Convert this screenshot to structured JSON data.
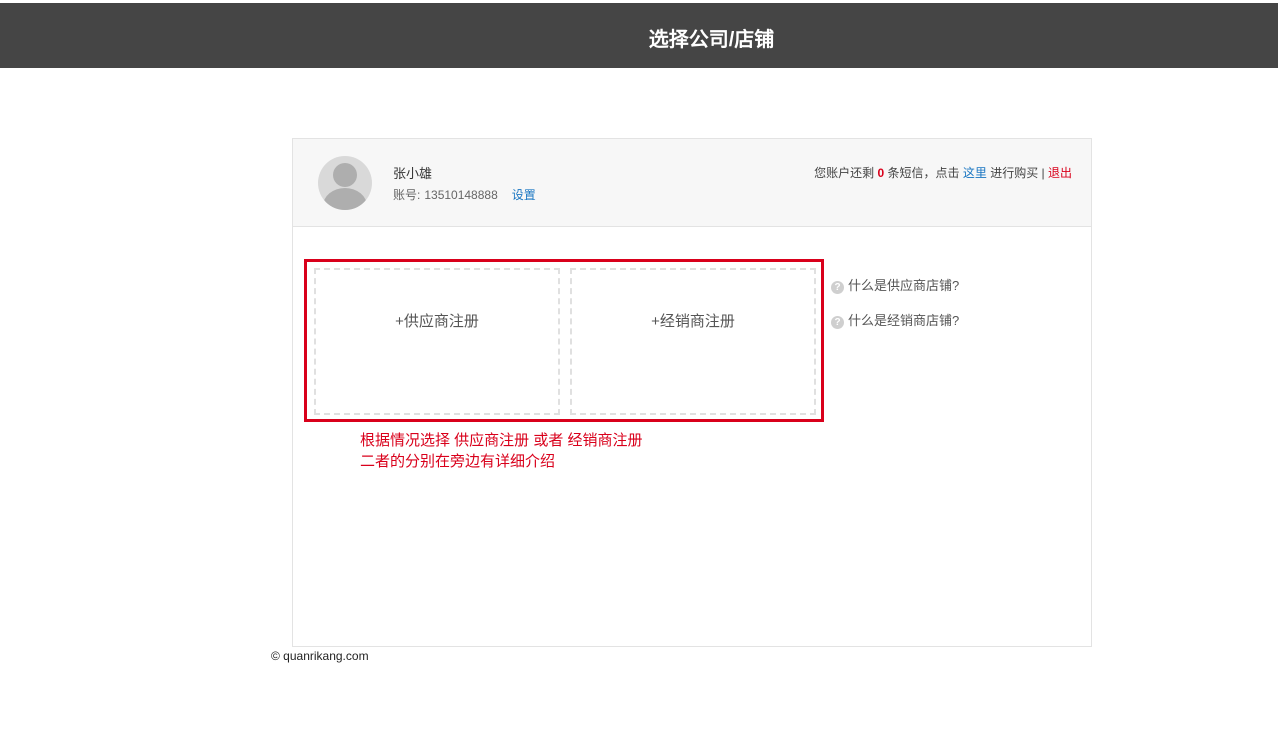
{
  "header": {
    "title": "选择公司/店铺"
  },
  "user": {
    "name": "张小雄",
    "account_label": "账号:",
    "account_number": "13510148888",
    "settings_label": "设置"
  },
  "sms": {
    "prefix": "您账户还剩",
    "count": "0",
    "middle": "条短信，点击",
    "link": "这里",
    "suffix": "进行购买 |",
    "logout": "退出"
  },
  "cards": {
    "supplier": "+供应商注册",
    "distributor": "+经销商注册"
  },
  "help": {
    "supplier_q": "什么是供应商店铺?",
    "distributor_q": "什么是经销商店铺?",
    "icon_glyph": "?"
  },
  "annotation": {
    "line1": "根据情况选择 供应商注册 或者 经销商注册",
    "line2": "二者的分别在旁边有详细介绍"
  },
  "footer": {
    "copyright": "© quanrikang.com"
  },
  "colors": {
    "header_bg": "#454545",
    "accent_red": "#d9001b",
    "link_blue": "#1a76c2"
  }
}
